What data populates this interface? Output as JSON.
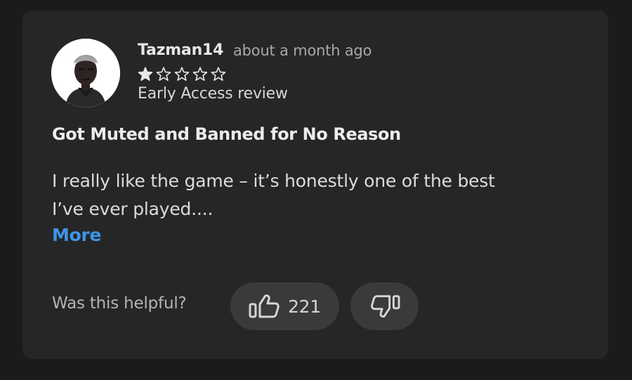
{
  "review": {
    "username": "Tazman14",
    "timestamp": "about a month ago",
    "rating": 1,
    "max_rating": 5,
    "review_type": "Early Access review",
    "title": "Got Muted and Banned for No Reason",
    "body_lines": [
      "I really like the game – it’s honestly one of the best",
      "I’ve ever played...."
    ],
    "more_label": "More"
  },
  "feedback": {
    "prompt": "Was this helpful?",
    "helpful_count": "221",
    "thumbs_up_icon": "thumbs-up-icon",
    "thumbs_down_icon": "thumbs-down-icon"
  },
  "colors": {
    "background": "#1b1b1b",
    "card": "#262626",
    "pill": "#3a3a3a",
    "link": "#3d95e8"
  }
}
